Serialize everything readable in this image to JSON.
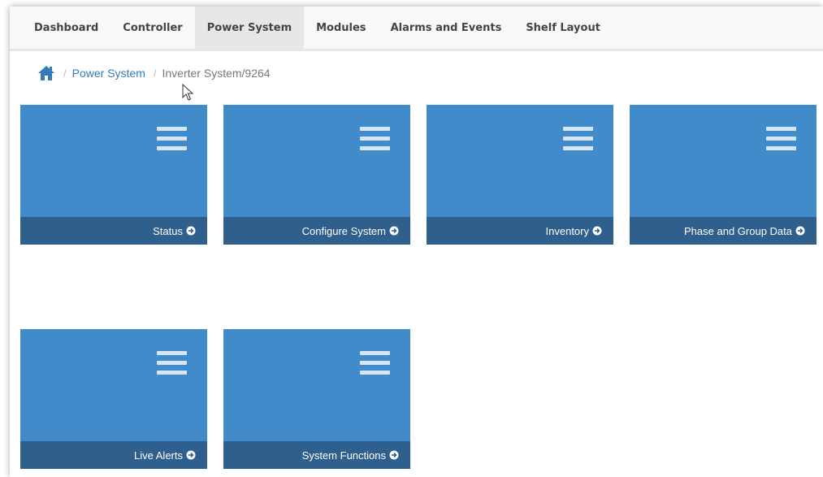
{
  "nav": {
    "tabs": [
      {
        "label": "Dashboard"
      },
      {
        "label": "Controller"
      },
      {
        "label": "Power System"
      },
      {
        "label": "Modules"
      },
      {
        "label": "Alarms and Events"
      },
      {
        "label": "Shelf Layout"
      }
    ],
    "active_tab": "Power System"
  },
  "breadcrumb": {
    "separator": "/",
    "link": "Power System",
    "current": "Inverter System/9264"
  },
  "tiles": [
    {
      "label": "Status"
    },
    {
      "label": "Configure System"
    },
    {
      "label": "Inventory"
    },
    {
      "label": "Phase and Group Data"
    },
    {
      "label": "Live Alerts"
    },
    {
      "label": "System Functions"
    }
  ],
  "icons": {
    "home": "home-icon",
    "tile_menu": "hamburger-menu-icon",
    "tile_arrow": "circle-arrow-right-icon",
    "pointer": "mouse-pointer-icon"
  },
  "colors": {
    "tile": "#428bca",
    "tile_footer": "#2f5f8d",
    "link": "#337ab7",
    "navbar": "#f8f8f8",
    "active_tab": "#e7e7e7"
  }
}
